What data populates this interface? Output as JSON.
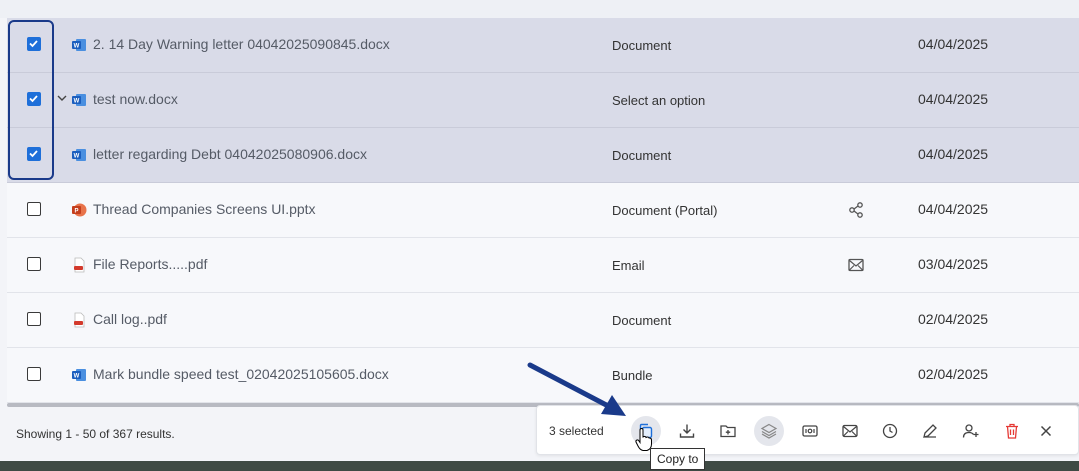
{
  "rows": [
    {
      "name": "2. 14 Day Warning letter 04042025090845.docx",
      "type": "Document",
      "date": "04/04/2025",
      "icon": "word-icon",
      "checked": true
    },
    {
      "name": "test now.docx",
      "type": "Select an option",
      "date": "04/04/2025",
      "icon": "word-icon",
      "checked": true
    },
    {
      "name": "letter regarding Debt 04042025080906.docx",
      "type": "Document",
      "date": "04/04/2025",
      "icon": "word-icon",
      "checked": true
    },
    {
      "name": "Thread Companies Screens UI.pptx",
      "type": "Document (Portal)",
      "date": "04/04/2025",
      "icon": "powerpoint-icon",
      "checked": false
    },
    {
      "name": "File Reports.....pdf",
      "type": "Email",
      "date": "03/04/2025",
      "icon": "pdf-icon",
      "checked": false
    },
    {
      "name": "Call log..pdf",
      "type": "Document",
      "date": "02/04/2025",
      "icon": "pdf-icon",
      "checked": false
    },
    {
      "name": "Mark bundle speed test_02042025105605.docx",
      "type": "Bundle",
      "date": "02/04/2025",
      "icon": "word-icon",
      "checked": false
    }
  ],
  "footer": {
    "results": "Showing 1 - 50 of 367 results."
  },
  "actionbar": {
    "selected": "3 selected",
    "buttons": [
      "copy-to",
      "download",
      "move-to-folder",
      "layers",
      "id-card",
      "email",
      "history",
      "edit",
      "add-user",
      "delete",
      "close"
    ]
  },
  "tooltip": "Copy to",
  "colors": {
    "accent": "#1e6fd9",
    "selection_row": "#d9dbe8",
    "annotation": "#1a3a8a",
    "delete": "#e53935"
  }
}
